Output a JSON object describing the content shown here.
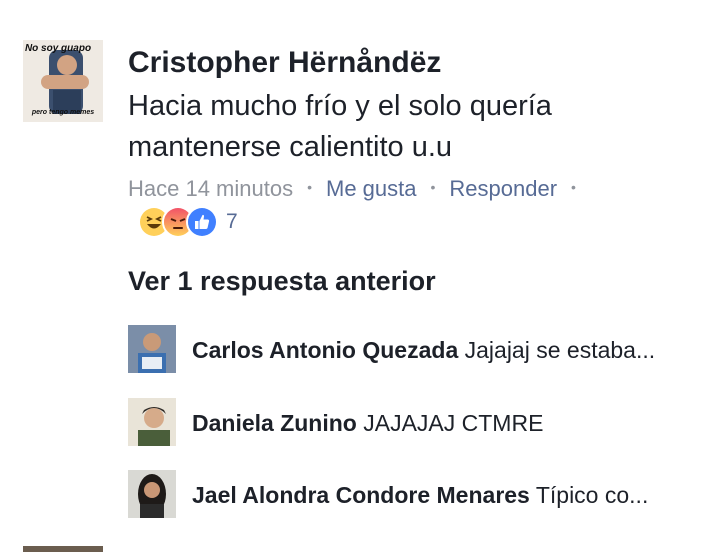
{
  "comment": {
    "author": "Cristopher Hërnåndëz",
    "text": "Hacia mucho frío y el solo quería mantenerse calientito u.u",
    "avatar_meme_top": "No soy guapo",
    "avatar_meme_bottom": "pero tengo memes",
    "time": "Hace 14 minutos",
    "like_label": "Me gusta",
    "reply_label": "Responder",
    "reactions": [
      "haha-icon",
      "angry-icon",
      "like-icon"
    ],
    "reaction_count": "7"
  },
  "view_previous": "Ver 1 respuesta anterior",
  "replies": [
    {
      "author": "Carlos Antonio Quezada",
      "text": "Jajajaj se estaba..."
    },
    {
      "author": "Daniela Zunino",
      "text": "JAJAJAJ CTMRE"
    },
    {
      "author": "Jael Alondra Condore Menares",
      "text": "Típico co..."
    }
  ],
  "colors": {
    "text": "#1d2129",
    "meta": "#90949c",
    "link": "#576b95",
    "like_blue": "#4080ff",
    "angry_red": "#f25268",
    "haha_yellow": "#ffd05a"
  }
}
